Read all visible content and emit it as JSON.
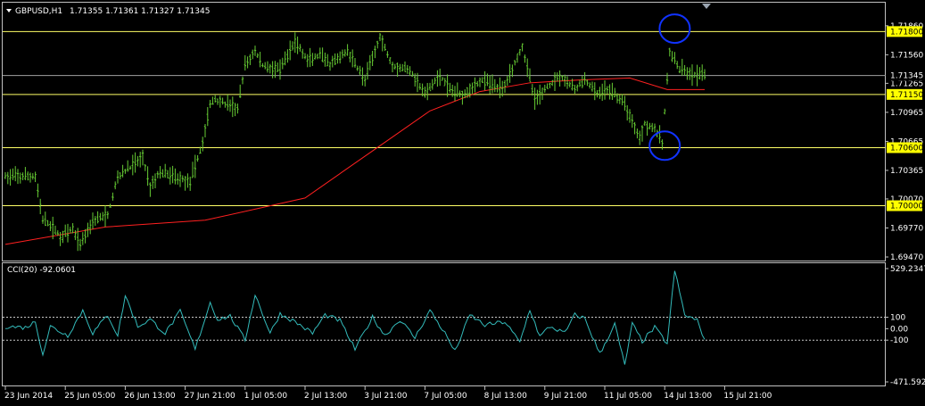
{
  "main_header": {
    "symbol": "GBPUSD,H1",
    "ohlc": "1.71355 1.71361 1.71327 1.71345"
  },
  "cci_header": {
    "label": "CCI(20) -92.0601"
  },
  "colors": {
    "background": "#000000",
    "frame": "#c0c0c0",
    "candles": "#66cc33",
    "moving_average": "#ff2020",
    "horizontal_levels": "#ffff66",
    "current_price_line": "#a0a0a0",
    "cci_line": "#33bbbb",
    "circles": "#1133ff",
    "axis_text": "#ffffff",
    "level_badge_bg": "#ffff00",
    "level_badge_text": "#000000"
  },
  "icons": {
    "menu": "triangle-down-icon",
    "shift_marker": "triangle-down-icon"
  },
  "chart_data": [
    {
      "type": "candlestick",
      "title": "GBPUSD,H1",
      "bar_count": 280,
      "ylim": [
        1.6947,
        1.7196
      ],
      "y_ticks": [
        "1.71860",
        "1.71560",
        "1.71265",
        "1.70965",
        "1.70665",
        "1.70365",
        "1.70070",
        "1.69770",
        "1.69470"
      ],
      "current_price": "1.71345",
      "horizontal_levels": [
        "1.71800",
        "1.71150",
        "1.70600",
        "1.70000"
      ],
      "moving_average": {
        "bars": [
          0,
          40,
          80,
          120,
          150,
          170,
          190,
          210,
          230,
          250,
          265,
          280
        ],
        "values": [
          1.696,
          1.6978,
          1.6985,
          1.7008,
          1.7062,
          1.7098,
          1.7118,
          1.7127,
          1.713,
          1.7132,
          1.712,
          1.712
        ]
      },
      "price_path": {
        "bars": [
          0,
          12,
          15,
          18,
          22,
          27,
          30,
          35,
          41,
          45,
          55,
          58,
          62,
          70,
          74,
          79,
          82,
          84,
          93,
          96,
          100,
          103,
          110,
          116,
          121,
          126,
          130,
          137,
          144,
          150,
          155,
          162,
          168,
          174,
          178,
          183,
          191,
          199,
          207,
          212,
          218,
          222,
          228,
          232,
          237,
          242,
          248,
          254,
          256,
          260,
          263,
          266,
          270,
          275,
          280
        ],
        "values": [
          1.703,
          1.703,
          1.6985,
          1.698,
          1.6968,
          1.6975,
          1.696,
          1.6985,
          1.699,
          1.703,
          1.705,
          1.702,
          1.7035,
          1.7028,
          1.7025,
          1.7065,
          1.7105,
          1.711,
          1.71,
          1.7145,
          1.716,
          1.7145,
          1.714,
          1.717,
          1.715,
          1.7155,
          1.7145,
          1.716,
          1.713,
          1.7175,
          1.7145,
          1.714,
          1.7115,
          1.7135,
          1.712,
          1.7115,
          1.713,
          1.712,
          1.7165,
          1.711,
          1.7125,
          1.7135,
          1.712,
          1.713,
          1.7115,
          1.712,
          1.7105,
          1.707,
          1.7085,
          1.708,
          1.7065,
          1.716,
          1.714,
          1.7135,
          1.71345
        ]
      },
      "annotations": [
        {
          "shape": "circle",
          "bar": 268,
          "value": 1.7183
        },
        {
          "shape": "circle",
          "bar": 264,
          "value": 1.7062
        }
      ]
    },
    {
      "type": "line",
      "title": "CCI(20) -92.0601",
      "ylim": [
        -480,
        540
      ],
      "y_ticks": [
        "529.2347",
        "100",
        "0.00",
        "-100",
        "-471.5922"
      ],
      "dashed_levels": [
        100,
        -100
      ],
      "points": {
        "bars": [
          0,
          8,
          12,
          15,
          18,
          25,
          31,
          35,
          41,
          45,
          48,
          53,
          58,
          64,
          70,
          76,
          82,
          85,
          90,
          96,
          100,
          106,
          110,
          116,
          123,
          128,
          134,
          140,
          147,
          152,
          158,
          164,
          170,
          176,
          180,
          186,
          192,
          200,
          206,
          210,
          214,
          218,
          224,
          228,
          232,
          238,
          244,
          248,
          251,
          255,
          260,
          265,
          268,
          272,
          277,
          280
        ],
        "values": [
          20,
          10,
          60,
          -220,
          20,
          -60,
          160,
          -40,
          120,
          -60,
          290,
          20,
          80,
          -40,
          150,
          -180,
          230,
          80,
          110,
          -100,
          300,
          -40,
          130,
          60,
          -40,
          120,
          70,
          -180,
          100,
          -60,
          80,
          -80,
          160,
          -40,
          -200,
          120,
          30,
          60,
          -120,
          170,
          -70,
          20,
          -40,
          120,
          90,
          -220,
          40,
          -320,
          40,
          -110,
          10,
          -130,
          510,
          120,
          70,
          -92
        ]
      }
    }
  ],
  "x_axis": {
    "labels": [
      {
        "bar": 0,
        "text": "23 Jun 2014"
      },
      {
        "bar": 24,
        "text": "25 Jun 05:00"
      },
      {
        "bar": 48,
        "text": "26 Jun 13:00"
      },
      {
        "bar": 72,
        "text": "27 Jun 21:00"
      },
      {
        "bar": 96,
        "text": "1 Jul 05:00"
      },
      {
        "bar": 120,
        "text": "2 Jul 13:00"
      },
      {
        "bar": 144,
        "text": "3 Jul 21:00"
      },
      {
        "bar": 168,
        "text": "7 Jul 05:00"
      },
      {
        "bar": 192,
        "text": "8 Jul 13:00"
      },
      {
        "bar": 216,
        "text": "9 Jul 21:00"
      },
      {
        "bar": 240,
        "text": "11 Jul 05:00"
      },
      {
        "bar": 264,
        "text": "14 Jul 13:00"
      },
      {
        "bar": 288,
        "text": "15 Jul 21:00"
      }
    ]
  }
}
